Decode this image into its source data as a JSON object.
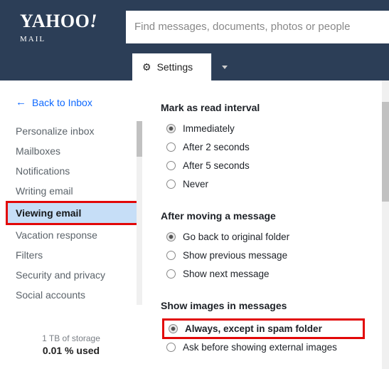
{
  "brand": {
    "name": "YAHOO",
    "suffix": "!",
    "sub": "MAIL"
  },
  "search": {
    "placeholder": "Find messages, documents, photos or people"
  },
  "tab": {
    "label": "Settings"
  },
  "back": {
    "label": "Back to Inbox"
  },
  "sidebar": {
    "items": [
      {
        "label": "Personalize inbox"
      },
      {
        "label": "Mailboxes"
      },
      {
        "label": "Notifications"
      },
      {
        "label": "Writing email"
      },
      {
        "label": "Viewing email"
      },
      {
        "label": "Vacation response"
      },
      {
        "label": "Filters"
      },
      {
        "label": "Security and privacy"
      },
      {
        "label": "Social accounts"
      }
    ]
  },
  "storage": {
    "line1": "1 TB of storage",
    "line2": "0.01 % used"
  },
  "sections": {
    "read": {
      "title": "Mark as read interval",
      "opts": [
        "Immediately",
        "After 2 seconds",
        "After 5 seconds",
        "Never"
      ]
    },
    "move": {
      "title": "After moving a message",
      "opts": [
        "Go back to original folder",
        "Show previous message",
        "Show next message"
      ]
    },
    "images": {
      "title": "Show images in messages",
      "opts": [
        "Always, except in spam folder",
        "Ask before showing external images"
      ]
    }
  }
}
